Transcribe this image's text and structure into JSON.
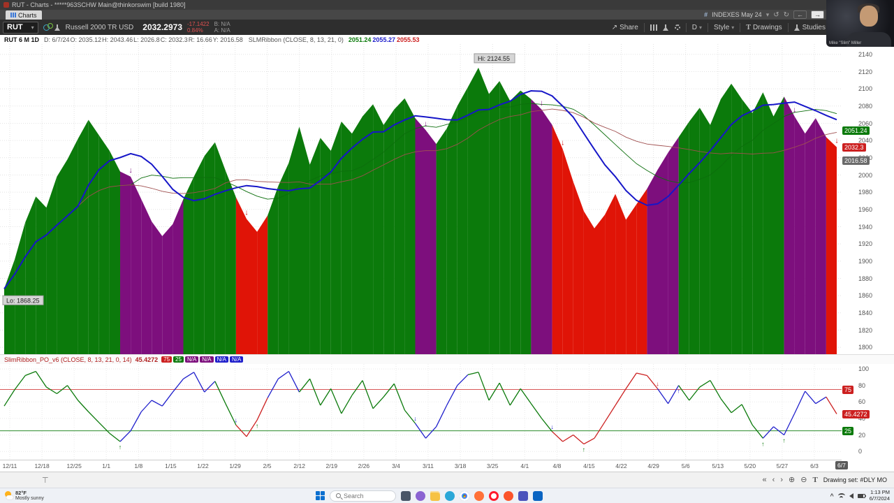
{
  "window": {
    "title": "RUT - Charts - *****963SCHW Main@thinkorswim [build 1980]"
  },
  "tab_bar": {
    "charts_label": "Charts"
  },
  "header_right": {
    "watchlist_label": "INDEXES May 24"
  },
  "icons": {
    "hash": "#",
    "undo": "↺",
    "redo": "↻",
    "back": "←",
    "forward": "→",
    "chevron_down": "▾",
    "share": "↗",
    "zoom_in": "⊕",
    "zoom_out": "⊖",
    "nav_fast_back": "«",
    "nav_back": "‹",
    "nav_forward": "›",
    "text_tool": "T",
    "restore_panel": "⊤",
    "tray_chevron": "^"
  },
  "toolbar": {
    "symbol": "RUT",
    "description": "Russell 2000 TR USD",
    "last_price": "2032.2973",
    "change": "-17.1422",
    "change_percent": "0.84%",
    "bid": "B: N/A",
    "ask": "A: N/A",
    "share_label": "Share",
    "timeframe_label": "D",
    "style_label": "Style",
    "drawings_label": "Drawings",
    "studies_label": "Studies"
  },
  "chart_header": {
    "title": "RUT 6 M 1D",
    "fields": [
      "D: 6/7/24",
      "O: 2035.12",
      "H: 2043.46",
      "L: 2026.8",
      "C: 2032.3",
      "R: 16.66",
      "Y: 2016.58"
    ],
    "study_label": "SLMRibbon (CLOSE, 8, 13, 21, 0)",
    "values": [
      {
        "text": "2051.24",
        "color": "#0b7a0b"
      },
      {
        "text": "2055.27",
        "color": "#2020cc"
      },
      {
        "text": "2055.53",
        "color": "#cc2020"
      }
    ]
  },
  "study_header": {
    "label": "SlimRibbon_PO_v6 (CLOSE, 8, 13, 21, 0, 14)",
    "value": "45.4272",
    "chips": [
      {
        "text": "75",
        "bg": "#cc2020"
      },
      {
        "text": "25",
        "bg": "#0b7a0b"
      },
      {
        "text": "N/A",
        "bg": "#7d0f7d"
      },
      {
        "text": "N/A",
        "bg": "#7d0f7d"
      },
      {
        "text": "N/A",
        "bg": "#2020cc"
      },
      {
        "text": "N/A",
        "bg": "#2020cc"
      }
    ]
  },
  "x_axis": {
    "labels": [
      "12/11",
      "12/18",
      "12/25",
      "1/1",
      "1/8",
      "1/15",
      "1/22",
      "1/29",
      "2/5",
      "2/12",
      "2/19",
      "2/26",
      "3/4",
      "3/11",
      "3/18",
      "3/25",
      "4/1",
      "4/8",
      "4/15",
      "4/22",
      "4/29",
      "5/6",
      "5/13",
      "5/20",
      "5/27",
      "6/3"
    ],
    "current_chip": "6/7"
  },
  "bottom_bar": {
    "drawing_set_label": "Drawing set: #DLY MO"
  },
  "taskbar": {
    "weather_temp": "82°F",
    "weather_desc": "Mostly sunny",
    "search_placeholder": "Search",
    "clock_time": "1:13 PM",
    "clock_date": "6/7/2024",
    "app_icons": [
      {
        "name": "task-view",
        "color": "#4a5668",
        "shape": "square"
      },
      {
        "name": "copilot",
        "color": "#8a63d2",
        "shape": "circle"
      },
      {
        "name": "file-explorer",
        "color": "#f6c243",
        "shape": "folder"
      },
      {
        "name": "edge",
        "color": "#2aa7d8",
        "shape": "circle"
      },
      {
        "name": "chrome",
        "color": "#e94235",
        "shape": "conic"
      },
      {
        "name": "firefox",
        "color": "#ff7139",
        "shape": "circle"
      },
      {
        "name": "opera",
        "color": "#ff1b2d",
        "shape": "ring"
      },
      {
        "name": "brave",
        "color": "#fb542b",
        "shape": "circle"
      },
      {
        "name": "teams",
        "color": "#4b53bc",
        "shape": "square"
      },
      {
        "name": "outlook",
        "color": "#0a64c2",
        "shape": "square"
      }
    ]
  },
  "webcam": {
    "caption": "Mike \"Slim\" Miller"
  },
  "chart_data": [
    {
      "id": "price",
      "type": "area",
      "title": "RUT 6 month daily price, area colored by SLMRibbon state (green/purple/red)",
      "ylim": [
        1800,
        2140
      ],
      "y_ticks": [
        2140,
        2120,
        2100,
        2080,
        2060,
        2040,
        2020,
        2000,
        1980,
        1960,
        1940,
        1920,
        1900,
        1880,
        1860,
        1840,
        1820,
        1800
      ],
      "hi_label": "Hi: 2124.55",
      "lo_label": "Lo: 1868.25",
      "colors": {
        "g": "#0b7a0b",
        "p": "#7d0f7d",
        "r": "#e01407",
        "b": "#2020cc"
      },
      "ma_line_colors": {
        "ma8": "#1616c8",
        "ma13": "#0c6e0c",
        "ma21": "#a05050"
      },
      "axis_chips": [
        {
          "text": "2051.24",
          "value": 2051.24,
          "bg": "#0b7a0b"
        },
        {
          "text": "2032.3",
          "value": 2032.3,
          "bg": "#cc2020"
        },
        {
          "text": "2016.58",
          "value": 2016.58,
          "bg": "#6a6a6a"
        }
      ],
      "series": [
        [
          1868,
          "g"
        ],
        [
          1902,
          "g"
        ],
        [
          1945,
          "g"
        ],
        [
          1975,
          "g"
        ],
        [
          1962,
          "g"
        ],
        [
          1998,
          "g"
        ],
        [
          2018,
          "g"
        ],
        [
          2042,
          "g"
        ],
        [
          2064,
          "g"
        ],
        [
          2046,
          "g"
        ],
        [
          2028,
          "g"
        ],
        [
          2004,
          "g"
        ],
        [
          1998,
          "p"
        ],
        [
          1972,
          "p"
        ],
        [
          1946,
          "p"
        ],
        [
          1929,
          "p"
        ],
        [
          1943,
          "p"
        ],
        [
          1972,
          "p"
        ],
        [
          1998,
          "g"
        ],
        [
          2022,
          "g"
        ],
        [
          2038,
          "g"
        ],
        [
          2005,
          "g"
        ],
        [
          1974,
          "g"
        ],
        [
          1949,
          "r"
        ],
        [
          1934,
          "r"
        ],
        [
          1953,
          "r"
        ],
        [
          1987,
          "g"
        ],
        [
          2014,
          "g"
        ],
        [
          2056,
          "g"
        ],
        [
          2012,
          "g"
        ],
        [
          2043,
          "g"
        ],
        [
          2028,
          "g"
        ],
        [
          2062,
          "g"
        ],
        [
          2048,
          "g"
        ],
        [
          2068,
          "g"
        ],
        [
          2082,
          "g"
        ],
        [
          2058,
          "g"
        ],
        [
          2076,
          "g"
        ],
        [
          2089,
          "g"
        ],
        [
          2066,
          "g"
        ],
        [
          2052,
          "p"
        ],
        [
          2036,
          "p"
        ],
        [
          2054,
          "g"
        ],
        [
          2080,
          "g"
        ],
        [
          2102,
          "g"
        ],
        [
          2124.55,
          "g"
        ],
        [
          2094,
          "g"
        ],
        [
          2109,
          "g"
        ],
        [
          2086,
          "g"
        ],
        [
          2098,
          "g"
        ],
        [
          2088,
          "g"
        ],
        [
          2076,
          "p"
        ],
        [
          2058,
          "p"
        ],
        [
          2030,
          "r"
        ],
        [
          1992,
          "r"
        ],
        [
          1958,
          "r"
        ],
        [
          1938,
          "r"
        ],
        [
          1954,
          "r"
        ],
        [
          1978,
          "r"
        ],
        [
          1948,
          "r"
        ],
        [
          1966,
          "r"
        ],
        [
          1984,
          "r"
        ],
        [
          2006,
          "p"
        ],
        [
          2026,
          "p"
        ],
        [
          2044,
          "p"
        ],
        [
          2062,
          "g"
        ],
        [
          2078,
          "g"
        ],
        [
          2058,
          "g"
        ],
        [
          2088,
          "g"
        ],
        [
          2106,
          "g"
        ],
        [
          2088,
          "g"
        ],
        [
          2072,
          "g"
        ],
        [
          2096,
          "g"
        ],
        [
          2068,
          "g"
        ],
        [
          2091,
          "g"
        ],
        [
          2068,
          "p"
        ],
        [
          2048,
          "p"
        ],
        [
          2066,
          "p"
        ],
        [
          2044,
          "p"
        ],
        [
          2032.3,
          "r"
        ]
      ],
      "markers": [
        {
          "i": 12,
          "d": "down",
          "color": "#7d0f7d"
        },
        {
          "i": 23,
          "d": "down",
          "color": "#cc2020"
        },
        {
          "i": 40,
          "d": "down",
          "color": "#7d0f7d"
        },
        {
          "i": 51,
          "d": "down",
          "color": "#7d0f7d"
        },
        {
          "i": 53,
          "d": "down",
          "color": "#cc2020"
        },
        {
          "i": 75,
          "d": "down",
          "color": "#7d0f7d"
        },
        {
          "i": 79,
          "d": "down",
          "color": "#cc2020"
        }
      ]
    },
    {
      "id": "oscillator",
      "type": "line",
      "title": "SlimRibbon_PO_v6 oscillator (0-100) with 75/25 bands",
      "ylim": [
        0,
        100
      ],
      "y_ticks": [
        100,
        80,
        60,
        40,
        20,
        0
      ],
      "colors": {
        "g": "#0b7a0b",
        "p": "#7d0f7d",
        "r": "#cc2020",
        "b": "#2020cc"
      },
      "hlines": [
        {
          "value": 75,
          "color": "#cc2020"
        },
        {
          "value": 25,
          "color": "#0b7a0b"
        }
      ],
      "axis_chips": [
        {
          "text": "75",
          "value": 75,
          "bg": "#cc2020"
        },
        {
          "text": "45.4272",
          "value": 45.43,
          "bg": "#cc2020"
        },
        {
          "text": "25",
          "value": 25,
          "bg": "#0b7a0b"
        }
      ],
      "series": [
        [
          55,
          "g"
        ],
        [
          75,
          "g"
        ],
        [
          92,
          "g"
        ],
        [
          97,
          "g"
        ],
        [
          78,
          "g"
        ],
        [
          70,
          "g"
        ],
        [
          80,
          "g"
        ],
        [
          62,
          "g"
        ],
        [
          48,
          "g"
        ],
        [
          35,
          "g"
        ],
        [
          22,
          "g"
        ],
        [
          12,
          "g"
        ],
        [
          25,
          "b"
        ],
        [
          48,
          "b"
        ],
        [
          62,
          "b"
        ],
        [
          55,
          "b"
        ],
        [
          72,
          "b"
        ],
        [
          88,
          "b"
        ],
        [
          96,
          "b"
        ],
        [
          72,
          "b"
        ],
        [
          85,
          "b"
        ],
        [
          58,
          "g"
        ],
        [
          32,
          "g"
        ],
        [
          18,
          "r"
        ],
        [
          38,
          "r"
        ],
        [
          65,
          "r"
        ],
        [
          88,
          "b"
        ],
        [
          97,
          "b"
        ],
        [
          72,
          "b"
        ],
        [
          88,
          "g"
        ],
        [
          56,
          "g"
        ],
        [
          76,
          "g"
        ],
        [
          46,
          "g"
        ],
        [
          68,
          "g"
        ],
        [
          86,
          "g"
        ],
        [
          52,
          "g"
        ],
        [
          66,
          "g"
        ],
        [
          82,
          "g"
        ],
        [
          50,
          "g"
        ],
        [
          34,
          "g"
        ],
        [
          16,
          "b"
        ],
        [
          30,
          "b"
        ],
        [
          56,
          "b"
        ],
        [
          80,
          "b"
        ],
        [
          93,
          "b"
        ],
        [
          96,
          "g"
        ],
        [
          62,
          "g"
        ],
        [
          83,
          "g"
        ],
        [
          56,
          "g"
        ],
        [
          76,
          "g"
        ],
        [
          58,
          "g"
        ],
        [
          40,
          "g"
        ],
        [
          24,
          "g"
        ],
        [
          12,
          "r"
        ],
        [
          20,
          "r"
        ],
        [
          9,
          "r"
        ],
        [
          16,
          "r"
        ],
        [
          36,
          "r"
        ],
        [
          56,
          "r"
        ],
        [
          76,
          "r"
        ],
        [
          95,
          "r"
        ],
        [
          92,
          "r"
        ],
        [
          76,
          "r"
        ],
        [
          58,
          "b"
        ],
        [
          80,
          "b"
        ],
        [
          62,
          "g"
        ],
        [
          78,
          "g"
        ],
        [
          86,
          "g"
        ],
        [
          64,
          "g"
        ],
        [
          47,
          "g"
        ],
        [
          57,
          "g"
        ],
        [
          32,
          "g"
        ],
        [
          16,
          "g"
        ],
        [
          30,
          "b"
        ],
        [
          20,
          "b"
        ],
        [
          46,
          "b"
        ],
        [
          73,
          "b"
        ],
        [
          58,
          "b"
        ],
        [
          66,
          "b"
        ],
        [
          45.43,
          "r"
        ]
      ],
      "markers": [
        {
          "i": 11,
          "d": "up",
          "color": "#0b7a0b"
        },
        {
          "i": 22,
          "d": "down",
          "color": "#2020cc"
        },
        {
          "i": 24,
          "d": "up",
          "color": "#0b7a0b"
        },
        {
          "i": 39,
          "d": "down",
          "color": "#2020cc"
        },
        {
          "i": 52,
          "d": "down",
          "color": "#2020cc"
        },
        {
          "i": 55,
          "d": "up",
          "color": "#0b7a0b"
        },
        {
          "i": 62,
          "d": "down",
          "color": "#cc2020"
        },
        {
          "i": 64,
          "d": "up",
          "color": "#2020cc"
        },
        {
          "i": 72,
          "d": "up",
          "color": "#0b7a0b"
        },
        {
          "i": 74,
          "d": "up",
          "color": "#0b7a0b"
        }
      ]
    }
  ]
}
